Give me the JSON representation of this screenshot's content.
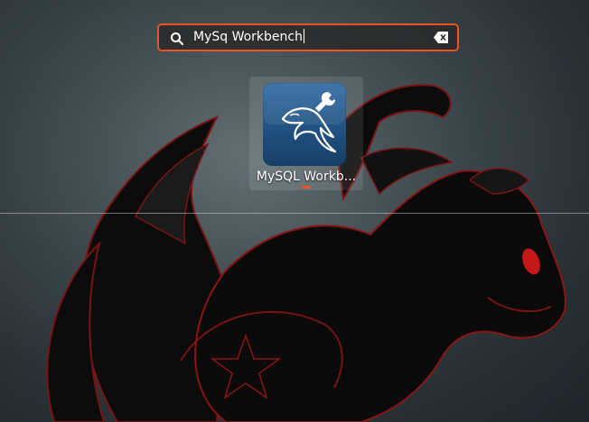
{
  "search": {
    "value": "MySq Workbench",
    "icon": "search-icon",
    "clear_icon": "clear-text-icon"
  },
  "results": [
    {
      "label": "MySQL Workb...",
      "icon": "mysql-workbench-icon",
      "running": true
    }
  ],
  "colors": {
    "accent": "#e95420",
    "icon_bg": "#1f4e79"
  }
}
